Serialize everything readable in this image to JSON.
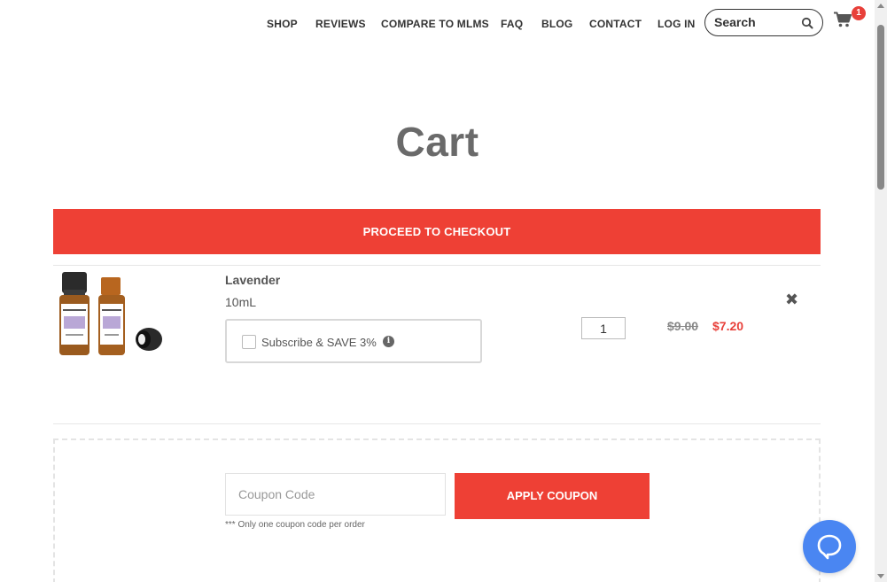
{
  "nav": {
    "items": [
      "SHOP",
      "REVIEWS",
      "COMPARE TO MLMS",
      "FAQ",
      "BLOG",
      "CONTACT",
      "LOG IN"
    ],
    "search_placeholder": "Search",
    "cart_count": "1",
    "icons": [
      "search-icon",
      "cart-icon"
    ]
  },
  "page": {
    "title": "Cart",
    "checkout_label": "PROCEED TO CHECKOUT"
  },
  "cart": {
    "items": [
      {
        "name": "Lavender",
        "size": "10mL",
        "subscribe_label": "Subscribe & SAVE 3%",
        "quantity": "1",
        "original_price": "$9.00",
        "sale_price": "$7.20"
      }
    ]
  },
  "coupon": {
    "placeholder": "Coupon Code",
    "apply_label": "APPLY COUPON",
    "note": "*** Only one coupon code per order"
  },
  "colors": {
    "accent": "#ee4035",
    "chat": "#4a86f2"
  }
}
